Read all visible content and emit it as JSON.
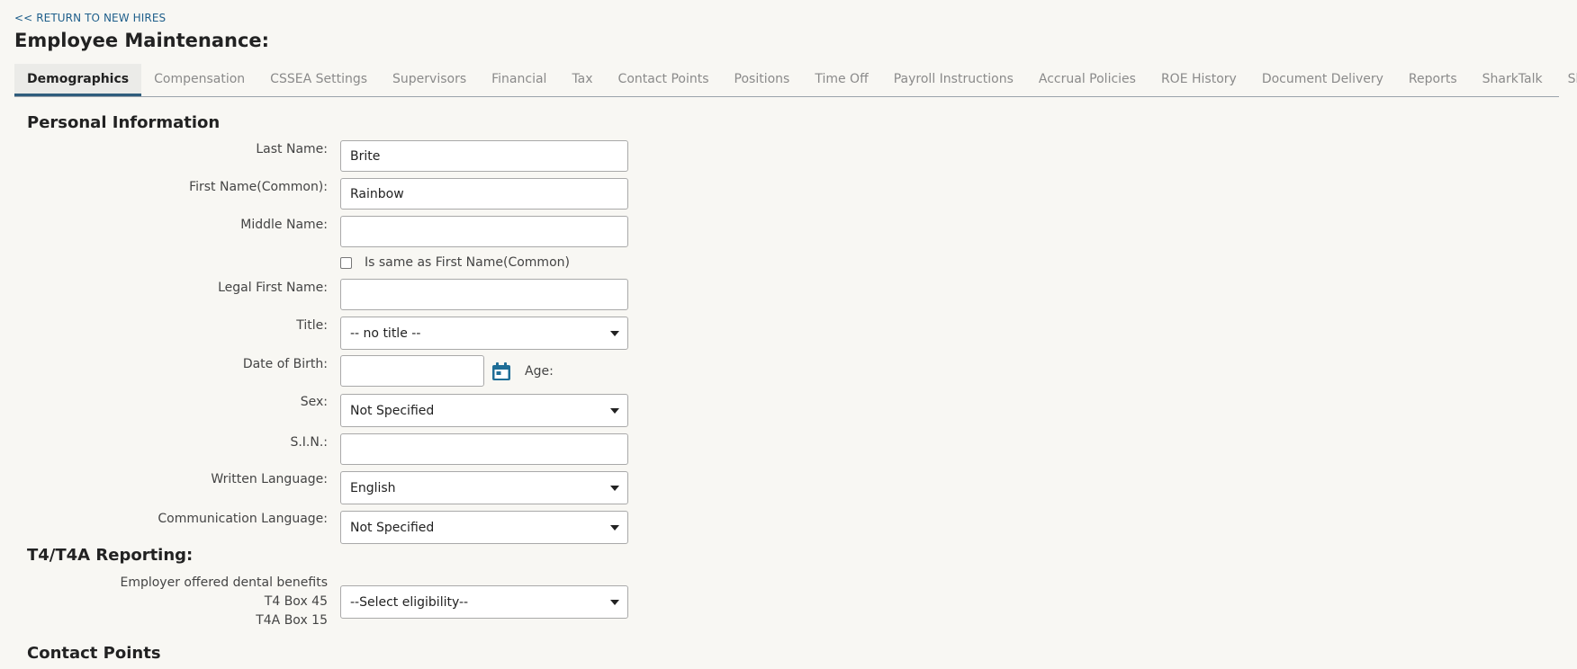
{
  "nav": {
    "back_link": "<< RETURN TO NEW HIRES"
  },
  "page": {
    "title": "Employee Maintenance:"
  },
  "tabs": [
    {
      "label": "Demographics",
      "active": true
    },
    {
      "label": "Compensation"
    },
    {
      "label": "CSSEA Settings"
    },
    {
      "label": "Supervisors"
    },
    {
      "label": "Financial"
    },
    {
      "label": "Tax"
    },
    {
      "label": "Contact Points"
    },
    {
      "label": "Positions"
    },
    {
      "label": "Time Off"
    },
    {
      "label": "Payroll Instructions"
    },
    {
      "label": "Accrual Policies"
    },
    {
      "label": "ROE History"
    },
    {
      "label": "Document Delivery"
    },
    {
      "label": "Reports"
    },
    {
      "label": "SharkTalk"
    },
    {
      "label": "ShiftShark"
    }
  ],
  "personal": {
    "heading": "Personal Information",
    "last_name": {
      "label": "Last Name:",
      "value": "Brite"
    },
    "first_name": {
      "label": "First Name(Common):",
      "value": "Rainbow"
    },
    "middle_name": {
      "label": "Middle Name:",
      "value": ""
    },
    "same_as_first": {
      "label": "Is same as First Name(Common)",
      "checked": false
    },
    "legal_first_name": {
      "label": "Legal First Name:",
      "value": ""
    },
    "title": {
      "label": "Title:",
      "value": "-- no title --"
    },
    "dob": {
      "label": "Date of Birth:",
      "value": "",
      "icon": "calendar-icon"
    },
    "age": {
      "label": "Age:"
    },
    "sex": {
      "label": "Sex:",
      "value": "Not Specified"
    },
    "sin": {
      "label": "S.I.N.:",
      "value": ""
    },
    "written_language": {
      "label": "Written Language:",
      "value": "English"
    },
    "communication_language": {
      "label": "Communication Language:",
      "value": "Not Specified"
    }
  },
  "t4": {
    "heading": "T4/T4A Reporting:",
    "dental_label_1": "Employer offered dental benefits",
    "dental_label_2": "T4 Box 45",
    "dental_label_3": "T4A Box 15",
    "dental_value": "--Select eligibility--"
  },
  "contact": {
    "heading": "Contact Points"
  },
  "colors": {
    "link": "#1f5f8b",
    "active_tab_underline": "#2f5d7c",
    "background": "#f8f7f3",
    "calendar_icon": "#1f6e97"
  }
}
